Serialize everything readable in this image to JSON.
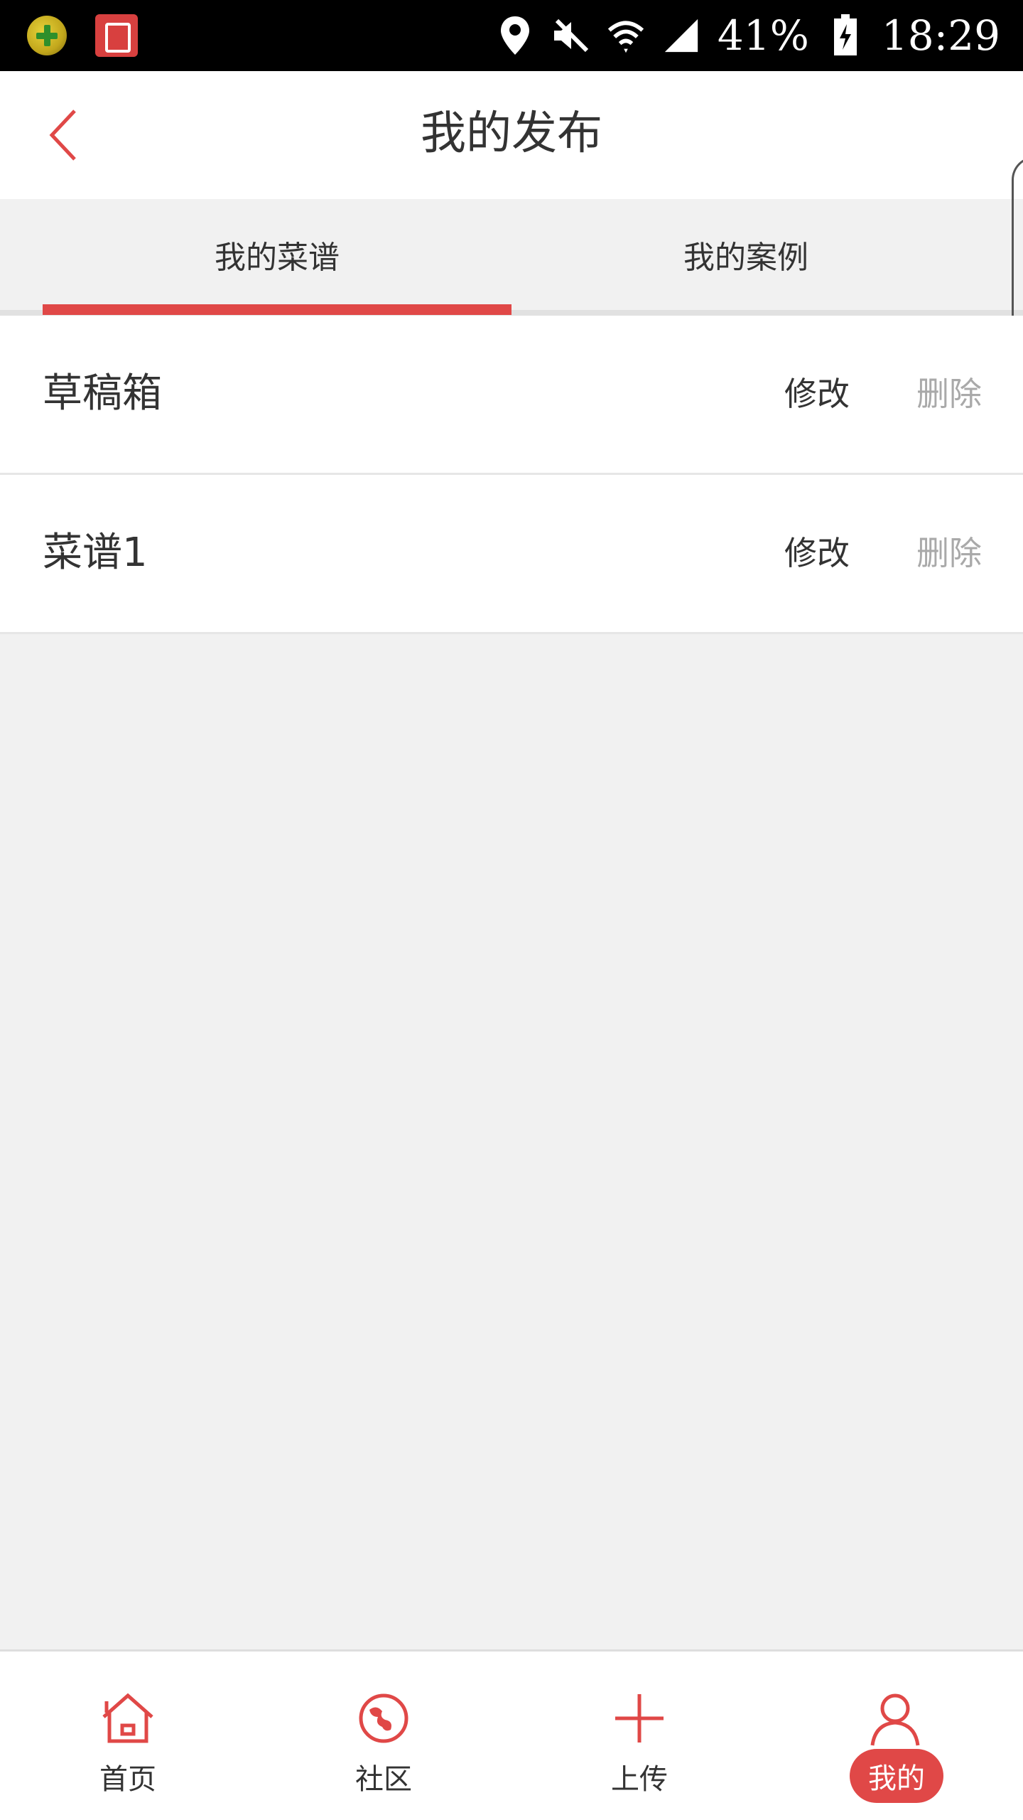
{
  "status_bar": {
    "battery_percent": "41%",
    "time": "18:29",
    "icons": [
      "app-360-icon",
      "app-notebook-icon",
      "location-icon",
      "mute-icon",
      "wifi-icon",
      "signal-icon",
      "battery-charging-icon"
    ]
  },
  "header": {
    "title": "我的发布",
    "back_icon": "chevron-left-icon"
  },
  "tabs": [
    {
      "label": "我的菜谱",
      "active": true
    },
    {
      "label": "我的案例",
      "active": false
    }
  ],
  "list": [
    {
      "title": "草稿箱",
      "edit_label": "修改",
      "delete_label": "删除"
    },
    {
      "title": "菜谱1",
      "edit_label": "修改",
      "delete_label": "删除"
    }
  ],
  "bottom_nav": [
    {
      "label": "首页",
      "icon": "home-icon",
      "active": false
    },
    {
      "label": "社区",
      "icon": "globe-icon",
      "active": false
    },
    {
      "label": "上传",
      "icon": "plus-icon",
      "active": false
    },
    {
      "label": "我的",
      "icon": "user-icon",
      "active": true
    }
  ],
  "colors": {
    "accent": "#e04847",
    "background": "#f1f1f1",
    "text": "#333333",
    "muted_text": "#a9a9a9"
  }
}
